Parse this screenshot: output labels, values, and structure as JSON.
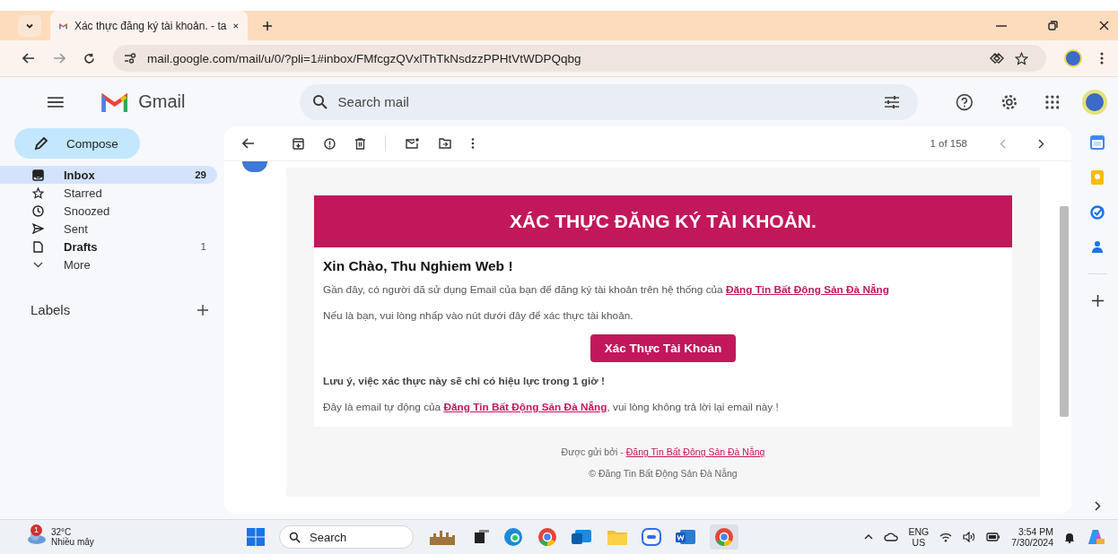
{
  "browser": {
    "tab_title": "Xác thực đăng ký tài khoản. - ta",
    "url": "mail.google.com/mail/u/0/?pli=1#inbox/FMfcgzQVxlThTkNsdzzPPHtVtWDPQqbg"
  },
  "gmail": {
    "product": "Gmail",
    "search_placeholder": "Search mail",
    "compose": "Compose",
    "sidebar": [
      {
        "kind": "inbox",
        "label": "Inbox",
        "count": "29",
        "unread": true,
        "selected": true
      },
      {
        "kind": "star",
        "label": "Starred",
        "unread": false,
        "selected": false
      },
      {
        "kind": "clock",
        "label": "Snoozed",
        "unread": false,
        "selected": false
      },
      {
        "kind": "send",
        "label": "Sent",
        "unread": false,
        "selected": false
      },
      {
        "kind": "draft",
        "label": "Drafts",
        "count": "1",
        "unread": true,
        "selected": false
      },
      {
        "kind": "more",
        "label": "More",
        "unread": false,
        "selected": false
      }
    ],
    "labels_heading": "Labels",
    "pager": "1 of 158"
  },
  "email": {
    "banner": "XÁC THỰC ĐĂNG KÝ TÀI KHOẢN.",
    "greeting": "Xin Chào, Thu Nghiem Web !",
    "paragraph_1": {
      "before": "Gần đây, có người đã sử dụng Email của bạn để đăng ký tài khoản trên hệ thống của ",
      "link": "Đăng Tin Bất Động Sản Đà Nẵng"
    },
    "paragraph_2": "Nếu là bạn, vui lòng nhấp vào nút dưới đây để xác thực tài khoản.",
    "button": "Xác Thực Tài Khoản",
    "note": "Lưu ý, việc xác thực này sẽ chỉ có hiệu lực trong 1 giờ !",
    "paragraph_3": {
      "before": "Đây là email tự động của ",
      "link": "Đăng Tin Bất Động Sản Đà Nẵng",
      "after": ", vui lòng không trả lời lại email này !"
    },
    "footer": {
      "before": "Được gửi bởi - ",
      "link": "Đăng Tin Bất Động Sản Đà Nẵng"
    },
    "copyright": "© Đăng Tin Bất Động Sản Đà Nẵng"
  },
  "taskbar": {
    "temperature": "32°C",
    "weather": "Nhiều mây",
    "weather_badge": "1",
    "search": "Search",
    "language": "ENG",
    "region": "US",
    "time": "3:54 PM",
    "date": "7/30/2024"
  }
}
